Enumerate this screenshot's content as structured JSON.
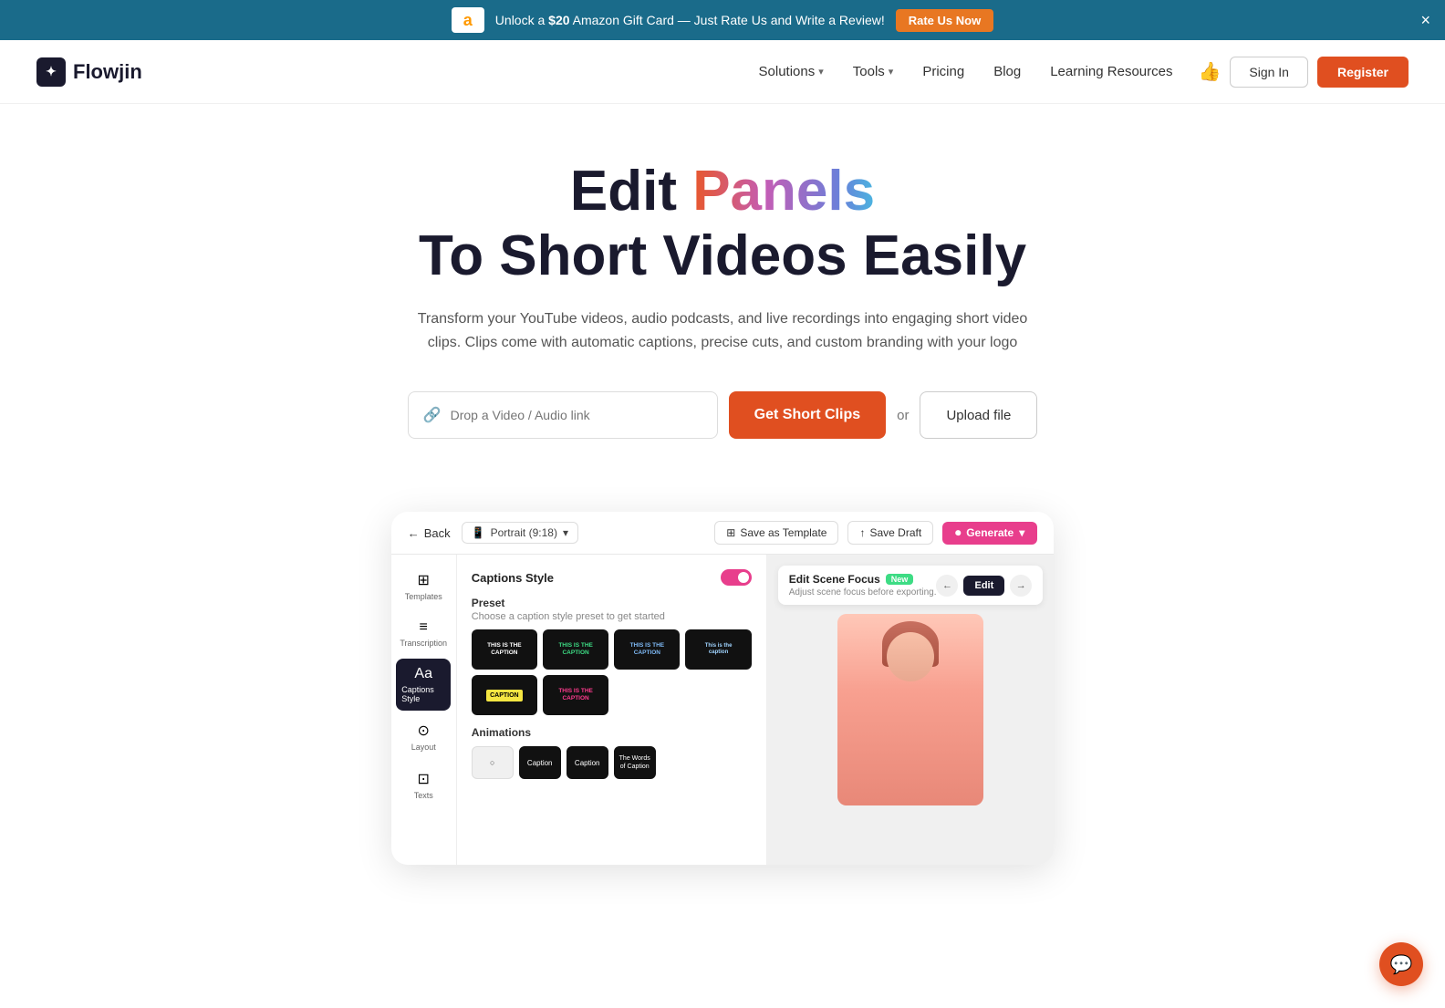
{
  "announce": {
    "prefix": "Unlock a ",
    "highlight": "$20",
    "suffix": " Amazon Gift Card — Just Rate Us and Write a Review!",
    "btn_label": "Rate Us Now",
    "close_label": "×"
  },
  "nav": {
    "logo_text": "Flowjin",
    "logo_icon": "✓",
    "items": [
      {
        "label": "Solutions",
        "has_dropdown": true
      },
      {
        "label": "Tools",
        "has_dropdown": true
      },
      {
        "label": "Pricing",
        "has_dropdown": false
      },
      {
        "label": "Blog",
        "has_dropdown": false
      },
      {
        "label": "Learning Resources",
        "has_dropdown": false
      }
    ],
    "sign_in": "Sign In",
    "register": "Register"
  },
  "hero": {
    "title_plain": "Edit ",
    "title_gradient": "Panels",
    "title_line2": "To Short Videos Easily",
    "subtitle": "Transform your YouTube videos, audio podcasts, and live recordings into engaging short video clips. Clips come with automatic captions, precise cuts, and custom branding with your logo",
    "input_placeholder": "Drop a Video / Audio link",
    "cta_btn": "Get Short Clips",
    "or_text": "or",
    "upload_btn": "Upload file"
  },
  "preview": {
    "back_label": "Back",
    "format_label": "Portrait (9:18)",
    "save_template": "Save as Template",
    "save_draft": "Save Draft",
    "generate": "Generate",
    "sidebar_items": [
      {
        "icon": "⊞",
        "label": "Templates"
      },
      {
        "icon": "≡",
        "label": "Transcription"
      },
      {
        "icon": "Aa",
        "label": "Captions Style",
        "active": true
      },
      {
        "icon": "⊙",
        "label": "Layout"
      },
      {
        "icon": "⊡",
        "label": "Texts"
      }
    ],
    "captions_section": "Captions Style",
    "preset_label": "Preset",
    "preset_desc": "Choose a caption style preset to get started",
    "caption_presets": [
      {
        "line1": "THIS IS THE",
        "line2": "CAPTION",
        "style": "default"
      },
      {
        "line1": "THIS IS THE",
        "line2": "CAPTION",
        "style": "green"
      },
      {
        "line1": "THIS IS THE",
        "line2": "CAPTION",
        "style": "blue"
      },
      {
        "line1": "This is the",
        "line2": "caption",
        "style": "normal"
      }
    ],
    "caption_presets_row2": [
      {
        "line1": "Caption",
        "style": "yellow"
      },
      {
        "line1": "THIS IS THE",
        "line2": "CAPTION",
        "style": "pink"
      }
    ],
    "animations_label": "Animations",
    "animation_presets": [
      {
        "label": "○",
        "style": "default"
      },
      {
        "label": "Caption",
        "style": "dark"
      },
      {
        "label": "Caption",
        "style": "dark"
      },
      {
        "label": "The Words of Caption",
        "style": "dark"
      }
    ],
    "edit_scene_title": "Edit Scene Focus",
    "edit_scene_badge": "New",
    "edit_scene_desc": "Adjust scene focus before exporting.",
    "edit_btn": "Edit"
  },
  "chat": {
    "icon": "💬"
  }
}
